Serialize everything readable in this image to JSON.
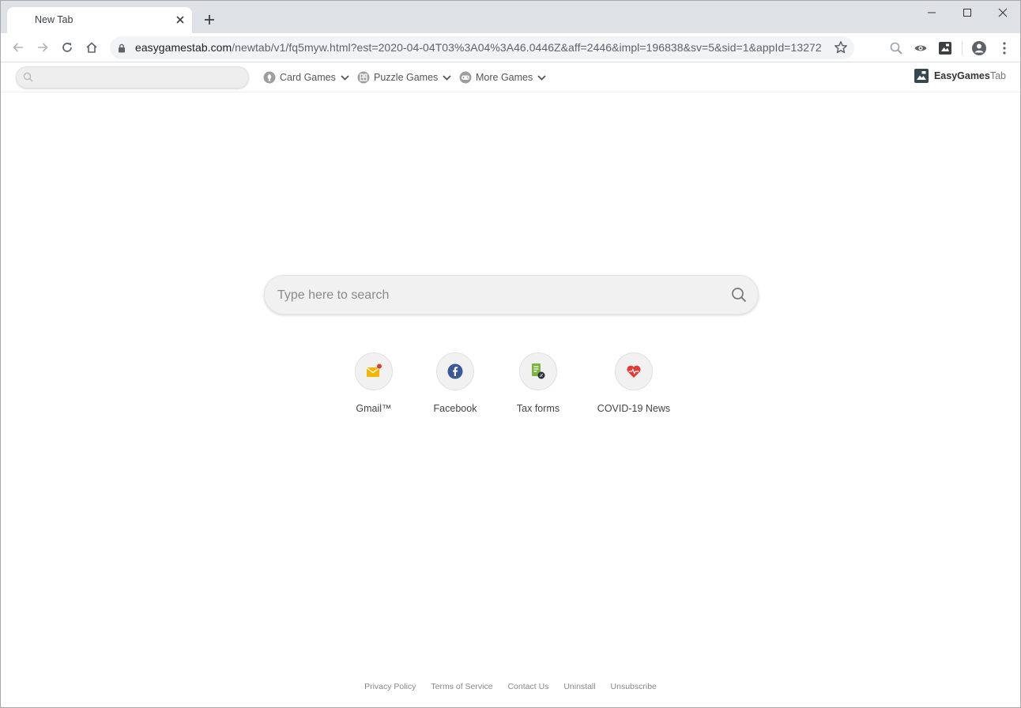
{
  "browser": {
    "tab_title": "New Tab",
    "url_host": "easygamestab.com",
    "url_rest": "/newtab/v1/fq5myw.html?est=2020-04-04T03%3A04%3A46.0446Z&aff=2446&impl=196838&sv=5&sid=1&appId=13272"
  },
  "extbar": {
    "search_placeholder": "",
    "menus": [
      {
        "label": "Card Games",
        "icon": "card-games-icon"
      },
      {
        "label": "Puzzle Games",
        "icon": "puzzle-games-icon"
      },
      {
        "label": "More Games",
        "icon": "gamepad-icon"
      }
    ],
    "brand_bold": "EasyGames",
    "brand_light": "Tab"
  },
  "main": {
    "search_placeholder": "Type here to search",
    "tiles": [
      {
        "label": "Gmail™",
        "icon": "gmail-icon"
      },
      {
        "label": "Facebook",
        "icon": "facebook-icon"
      },
      {
        "label": "Tax forms",
        "icon": "tax-forms-icon"
      },
      {
        "label": "COVID-19 News",
        "icon": "heart-pulse-icon"
      }
    ]
  },
  "footer": {
    "links": [
      "Privacy Policy",
      "Terms of Service",
      "Contact Us",
      "Uninstall",
      "Unsubscribe"
    ]
  },
  "colors": {
    "tabstrip": "#dee1e6",
    "omnibox": "#f1f3f4",
    "facebook": "#3b5998",
    "heart": "#e53935",
    "tax_green": "#7cb342",
    "gmail_yellow": "#f4b400"
  }
}
